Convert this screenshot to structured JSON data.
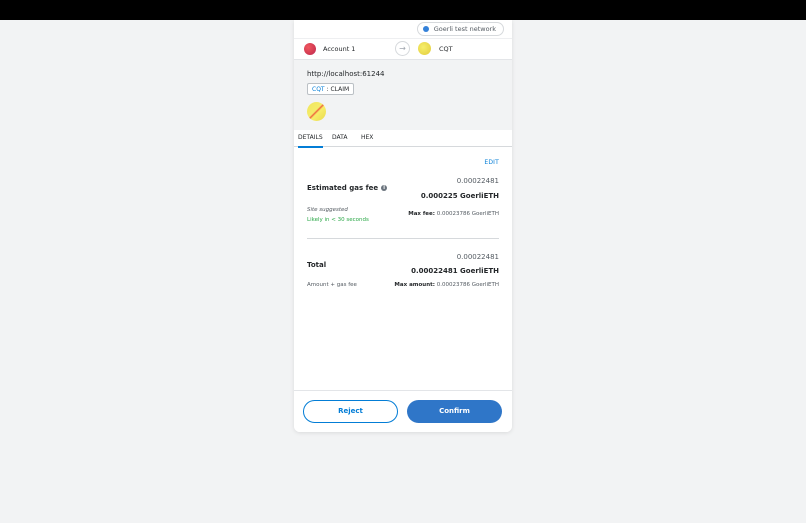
{
  "network": {
    "label": "Goerli test network",
    "dot_color": "#3481d9"
  },
  "account": {
    "name": "Account 1"
  },
  "recipient": {
    "name": "CQT"
  },
  "origin": {
    "url": "http://localhost:61244"
  },
  "method": {
    "token": "CQT",
    "separator": ":",
    "name": "CLAIM"
  },
  "tabs": [
    "DETAILS",
    "DATA",
    "HEX"
  ],
  "details": {
    "edit_label": "EDIT",
    "gas_fee_label": "Estimated gas fee",
    "gas_fee_secondary": "0.00022481",
    "gas_fee_primary": "0.000225 GoerliETH",
    "site_suggested": "Site suggested",
    "likely_time": "Likely in < 30 seconds",
    "max_fee_label": "Max fee:",
    "max_fee_value": "0.00023786 GoerliETH",
    "total_label": "Total",
    "total_secondary": "0.00022481",
    "total_primary": "0.00022481 GoerliETH",
    "amount_gas_label": "Amount + gas fee",
    "max_amount_label": "Max amount:",
    "max_amount_value": "0.00023786 GoerliETH"
  },
  "footer": {
    "reject_label": "Reject",
    "confirm_label": "Confirm"
  }
}
